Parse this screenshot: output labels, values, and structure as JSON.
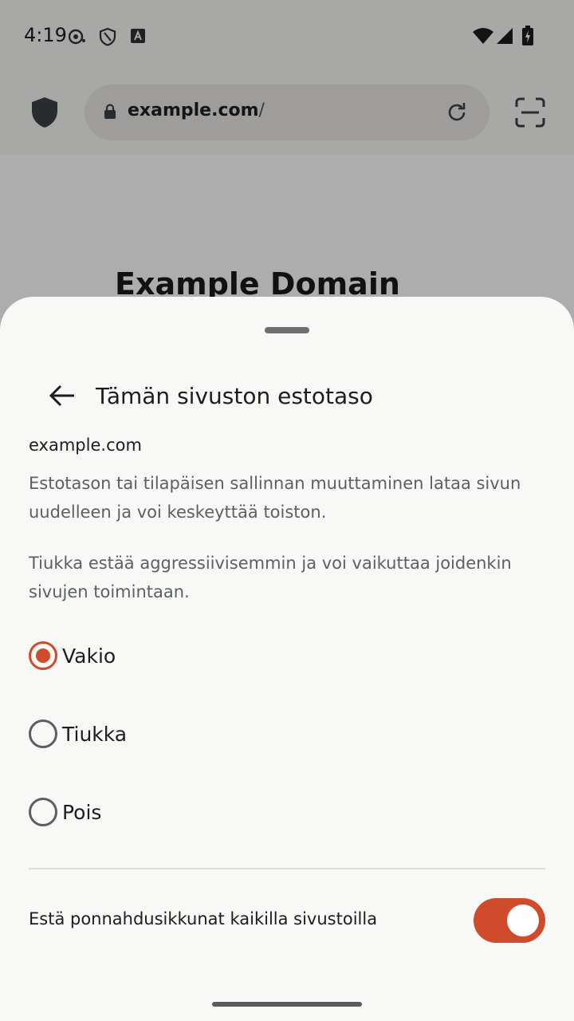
{
  "status_bar": {
    "time": "4:19",
    "icons": [
      "record-icon",
      "shield-outline-icon",
      "a-box-icon",
      "wifi-icon",
      "signal-icon",
      "battery-charging-icon"
    ]
  },
  "toolbar": {
    "url_host": "example.com",
    "url_path": "/",
    "icons": [
      "shield-icon",
      "lock-icon",
      "reload-icon",
      "scan-icon"
    ]
  },
  "page": {
    "heading": "Example Domain"
  },
  "sheet": {
    "title": "Tämän sivuston estotaso",
    "host": "example.com",
    "description_1": "Estotason tai tilapäisen sallinnan muuttaminen lataa sivun uudelleen ja voi keskeyttää toiston.",
    "description_2": "Tiukka estää aggressiivisemmin ja voi vaikuttaa joidenkin sivujen toimintaan.",
    "options": [
      {
        "label": "Vakio",
        "selected": true
      },
      {
        "label": "Tiukka",
        "selected": false
      },
      {
        "label": "Pois",
        "selected": false
      }
    ],
    "popup_toggle": {
      "label": "Estä ponnahdusikkunat kaikilla sivustoilla",
      "enabled": true
    }
  },
  "colors": {
    "accent": "#d04a2c",
    "sheet_background": "#f8f8f6",
    "secondary_text": "#5b6063"
  }
}
